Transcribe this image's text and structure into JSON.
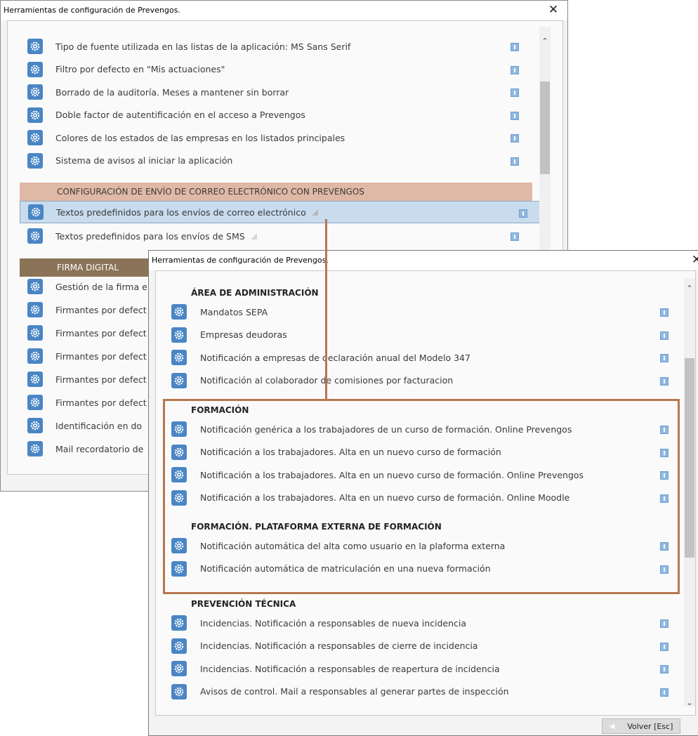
{
  "back_window": {
    "title": "Herramientas de configuración de Prevengos.",
    "close_glyph": "✕",
    "rows_top": [
      "Tipo de fuente utilizada en las listas de la aplicación: MS Sans Serif",
      "Filtro por defecto en \"Mis actuaciones\"",
      "Borrado de la auditoría. Meses a mantener sin borrar",
      "Doble factor de autentificación en el acceso a Prevengos",
      "Colores de los estados de las empresas en los listados principales",
      "Sistema de avisos al iniciar la aplicación"
    ],
    "email_header": "CONFIGURACIÓN DE ENVÍO DE CORREO ELECTRÓNICO CON PREVENGOS",
    "email_rows": [
      "Textos predefinidos para los envíos de correo electrónico",
      "Textos predefinidos para los envíos de SMS"
    ],
    "firma_header": "FIRMA DIGITAL",
    "firma_rows": [
      "Gestión de la firma e",
      "Firmantes por defect",
      "Firmantes por defect",
      "Firmantes por defect",
      "Firmantes por defect",
      "Firmantes por defect",
      "Identificación en do",
      "Mail recordatorio de"
    ]
  },
  "front_window": {
    "title": "Herramientas de configuración de Prevengos.",
    "close_glyph": "✕",
    "sections": [
      {
        "title": "ÁREA DE ADMINISTRACIÓN",
        "rows": [
          "Mandatos SEPA",
          "Empresas deudoras",
          "Notificación a empresas de declaración anual del Modelo 347",
          "Notificación al colaborador de comisiones por facturacion"
        ]
      },
      {
        "title": "FORMACIÓN",
        "rows": [
          "Notificación genérica a los trabajadores de un curso de formación. Online Prevengos",
          "Notificación a los trabajadores. Alta en un nuevo curso de formación",
          "Notificación a los trabajadores. Alta en un nuevo curso de formación. Online Prevengos",
          "Notificación a los trabajadores. Alta en un nuevo curso de formación. Online Moodle"
        ]
      },
      {
        "title": "FORMACIÓN. PLATAFORMA EXTERNA DE FORMACIÓN",
        "rows": [
          "Notificación automática del alta como usuario en la plaforma externa",
          "Notificación automática de matriculación en una nueva formación"
        ]
      },
      {
        "title": "PREVENCIÓN TÉCNICA",
        "rows": [
          "Incidencias. Notificación a responsables de nueva incidencia",
          "Incidencias. Notificación a responsables de cierre de incidencia",
          "Incidencias. Notificación a responsables de reapertura de incidencia",
          "Avisos de control. Mail a responsables al generar partes de inspección"
        ]
      }
    ],
    "back_button": "Volver [Esc]"
  },
  "colors": {
    "email_header_bg": "#e0b8a6",
    "firma_header_bg": "#8a7357",
    "annotation_line": "#b8774f",
    "gear_blue": "#4a86c5"
  }
}
